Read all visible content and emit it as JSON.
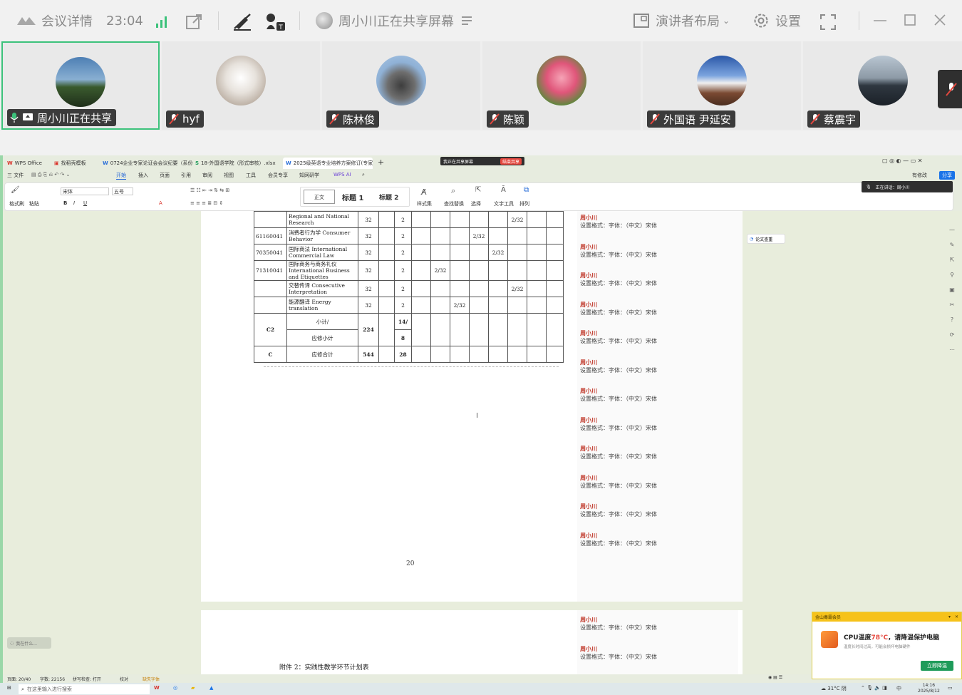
{
  "topbar": {
    "meeting_details": "会议详情",
    "time": "23:04",
    "sharing_banner": "周小川正在共享屏幕",
    "layout_label": "演讲者布局",
    "settings_label": "设置"
  },
  "participants": [
    {
      "name": "周小川正在共享",
      "sharing": true
    },
    {
      "name": "hyf"
    },
    {
      "name": "陈林俊"
    },
    {
      "name": "陈颖"
    },
    {
      "name": "外国语 尹延安"
    },
    {
      "name": "蔡震宇"
    }
  ],
  "wps": {
    "tabs": [
      "WPS Office",
      "找稻壳模板",
      "0724企业专家论证会会议纪要（系份",
      "18-外国语学院（形式审核）.xlsx",
      "2025级英语专业培养方案修订(专家"
    ],
    "sharing_indicator": "我正在共享屏幕",
    "stop_share": "结束共享",
    "menu": [
      "三 文件",
      "开始",
      "插入",
      "页面",
      "引用",
      "审阅",
      "视图",
      "工具",
      "会员专享",
      "知网研学",
      "WPS AI"
    ],
    "menu_right": [
      "有修改",
      "分享"
    ],
    "ribbon": {
      "format_painter": "格式刷",
      "paste": "粘贴",
      "font": "宋体",
      "size": "五号",
      "style_normal": "正文",
      "style_h1": "标题 1",
      "style_h2": "标题 2",
      "style_set": "样式集",
      "find_replace": "查找替换",
      "select": "选择",
      "text_tools": "文字工具",
      "arrange": "排列"
    },
    "speaker_label": "正在讲话：周小川",
    "paper_check": "论文查重",
    "table_rows": [
      {
        "code": "",
        "name_cn": "",
        "name_en": "Regional and National Research",
        "hours": "32",
        "credit": "2",
        "term": "2/32",
        "col": 5
      },
      {
        "code": "61160041",
        "name_cn": "消费者行为学",
        "name_en": "Consumer Behavior",
        "hours": "32",
        "credit": "2",
        "term": "2/32",
        "col": 3
      },
      {
        "code": "70350041",
        "name_cn": "国际商法",
        "name_en": "International Commercial Law",
        "hours": "32",
        "credit": "2",
        "term": "2/32",
        "col": 4
      },
      {
        "code": "71310041",
        "name_cn": "国际商务与商务礼仪",
        "name_en": "International Business and Etiquettes",
        "hours": "32",
        "credit": "2",
        "term": "2/32",
        "col": 1
      },
      {
        "code": "",
        "name_cn": "交替传译",
        "name_en": "Consecutive Interpretation",
        "hours": "32",
        "credit": "2",
        "term": "2/32",
        "col": 5
      },
      {
        "code": "",
        "name_cn": "能源翻译",
        "name_en": "Energy translation",
        "hours": "32",
        "credit": "2",
        "term": "2/32",
        "col": 2
      }
    ],
    "subtotal": {
      "group": "C2",
      "label1": "小计/",
      "label2": "应修小计",
      "hours": "224",
      "credit1": "14/",
      "credit2": "8"
    },
    "total": {
      "group": "C",
      "label": "应修合计",
      "hours": "544",
      "credit": "28"
    },
    "page_number": "20",
    "appendix_title": "附件 2：实践性教学环节计划表",
    "comment_author": "周小川",
    "comment_text": "设置格式：字体：（中文）宋体",
    "status": [
      "页面: 20/40",
      "字数: 22156",
      "拼写检查: 打开",
      "校对",
      "缺失字体"
    ],
    "search_placeholder": "在这里输入进行搜索",
    "ask_placeholder": "我在什么...",
    "weather": "31°C 阴",
    "tray_lang": "中",
    "clock_time": "14:16",
    "clock_date": "2025/8/12",
    "notification": {
      "header": "金山毒霸会员",
      "title_pre": "CPU温度",
      "temp": "78°C",
      "title_post": "，请降温保护电脑",
      "body": "温度长时间过高，可能会损坏电脑硬件",
      "button": "立即降温"
    }
  }
}
